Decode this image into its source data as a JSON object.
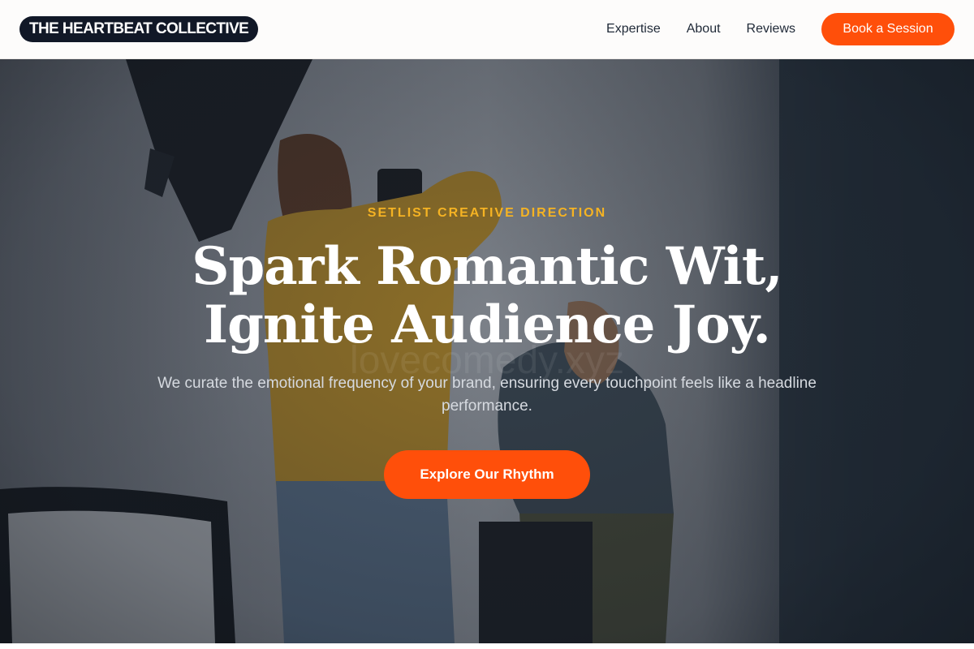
{
  "header": {
    "logo_text": "THE HEARTBEAT COLLECTIVE",
    "nav": [
      "Expertise",
      "About",
      "Reviews"
    ],
    "cta_label": "Book a Session"
  },
  "hero": {
    "eyebrow": "SETLIST CREATIVE DIRECTION",
    "headline_line1": "Spark Romantic Wit,",
    "headline_line2": "Ignite Audience Joy.",
    "subtext": "We curate the emotional frequency of your brand, ensuring every touchpoint feels like a headline performance.",
    "cta_label": "Explore Our Rhythm",
    "watermark": "lovecomedy.xyz"
  },
  "colors": {
    "accent": "#ff4f0a",
    "eyebrow": "#f5b323",
    "logo_bg": "#111827"
  }
}
